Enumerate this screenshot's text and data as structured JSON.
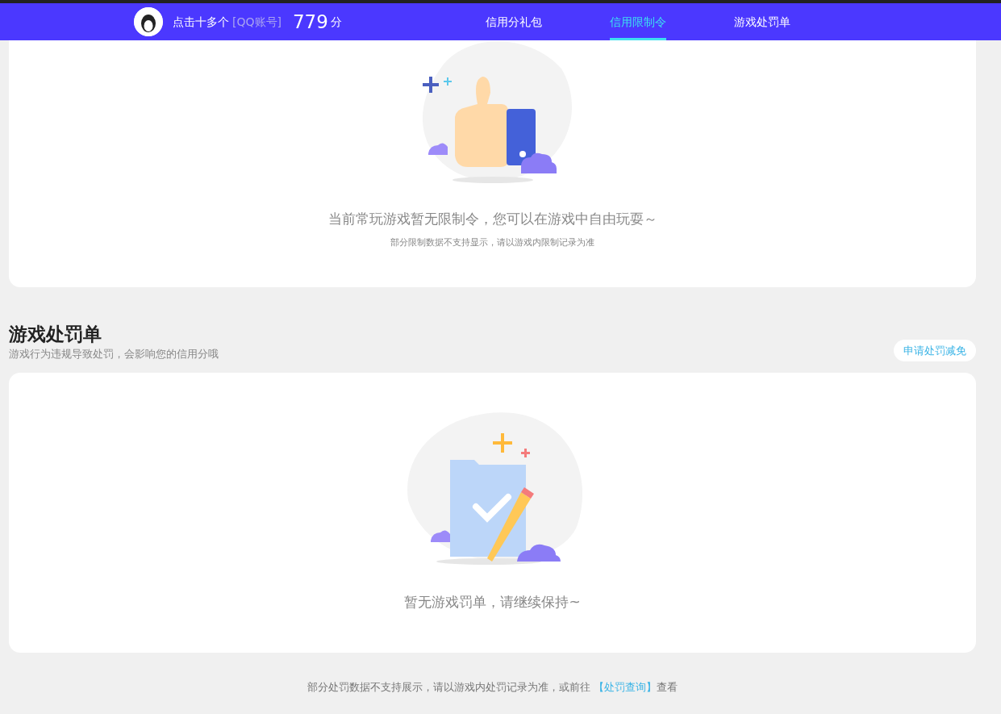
{
  "header": {
    "user_name": "点击十多个",
    "account_hint": "[QQ账号]",
    "score": "779",
    "score_unit": "分",
    "tabs": [
      {
        "label": "信用分礼包",
        "selected": false
      },
      {
        "label": "信用限制令",
        "selected": true
      },
      {
        "label": "游戏处罚单",
        "selected": false
      }
    ]
  },
  "restrictions": {
    "message": "当前常玩游戏暂无限制令，您可以在游戏中自由玩耍～",
    "note": "部分限制数据不支持显示，请以游戏内限制记录为准"
  },
  "penalties": {
    "title": "游戏处罚单",
    "subtitle": "游戏行为违规导致处罚，会影响您的信用分哦",
    "action": "申请处罚减免",
    "message": "暂无游戏罚单，请继续保持~"
  },
  "footer": {
    "before": "部分处罚数据不支持展示，请以游戏内处罚记录为准，或前往 ",
    "link": "【处罚查询】",
    "after": "查看"
  }
}
